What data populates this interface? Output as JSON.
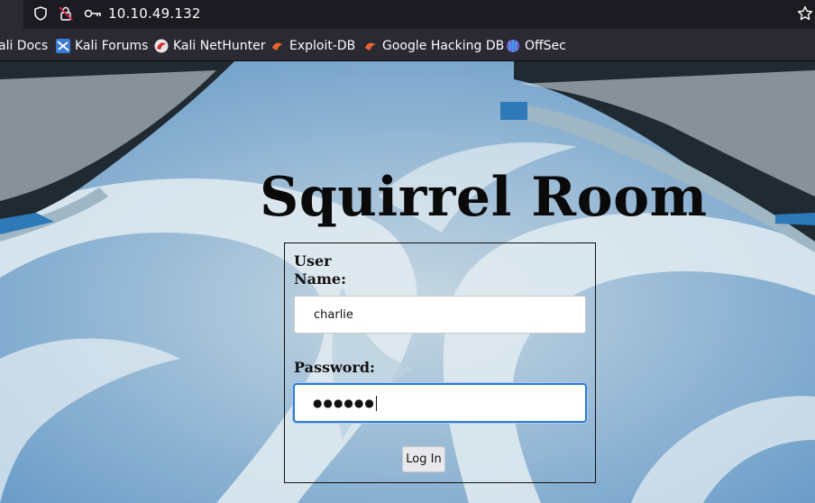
{
  "browser": {
    "url": "10.10.49.132"
  },
  "bookmarks": [
    {
      "label": "ali Docs",
      "icon": "kali-docs-icon"
    },
    {
      "label": "Kali Forums",
      "icon": "kali-forums-icon"
    },
    {
      "label": "Kali NetHunter",
      "icon": "kali-nethunter-icon"
    },
    {
      "label": "Exploit-DB",
      "icon": "exploit-db-icon"
    },
    {
      "label": "Google Hacking DB",
      "icon": "ghdb-icon"
    },
    {
      "label": "OffSec",
      "icon": "offsec-icon"
    }
  ],
  "page": {
    "title": "Squirrel Room",
    "form": {
      "username_label": "User Name:",
      "username_label_line1": "User",
      "username_label_line2": "Name:",
      "username_value": "charlie",
      "password_label": "Password:",
      "password_masked": "●●●●●●",
      "submit_label": "Log In"
    }
  },
  "colors": {
    "accent_focus": "#2f7ad6",
    "toolbar_bg": "#2b2a33",
    "urlbar_bg": "#1c1b22"
  }
}
